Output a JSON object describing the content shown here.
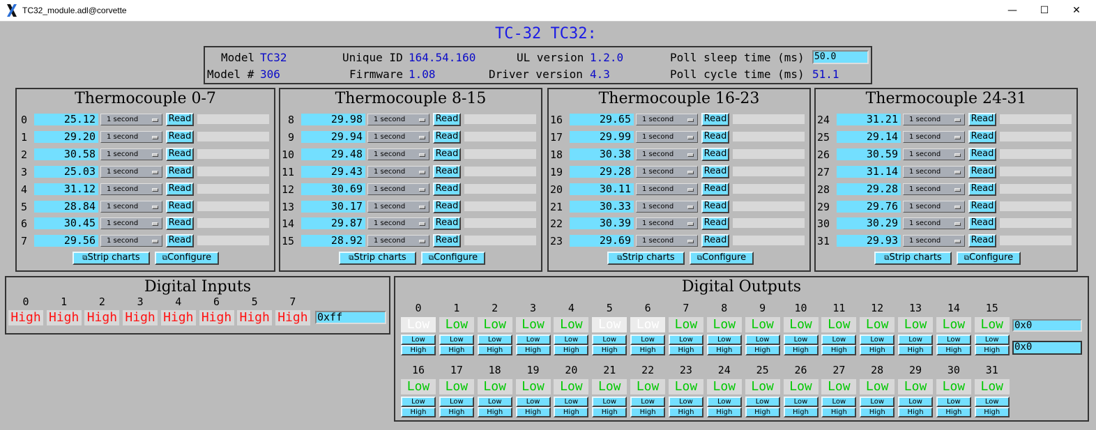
{
  "window": {
    "title": "TC32_module.adl@corvette",
    "minimize": "—",
    "maximize": "☐",
    "close": "✕"
  },
  "header": {
    "title": "TC-32  TC32:"
  },
  "info": {
    "model_label": "Model",
    "model_value": "TC32",
    "model_num_label": "Model #",
    "model_num_value": "306",
    "uid_label": "Unique ID",
    "uid_value": "164.54.160",
    "firmware_label": "Firmware",
    "firmware_value": "1.08",
    "ul_label": "UL version",
    "ul_value": "1.2.0",
    "driver_label": "Driver version",
    "driver_value": "4.3",
    "poll_sleep_label": "Poll sleep time (ms)",
    "poll_sleep_value": "50.0",
    "poll_cycle_label": "Poll cycle time (ms)",
    "poll_cycle_value": "51.1"
  },
  "thermocouples": {
    "scan_option": "1 second",
    "read_label": "Read",
    "strip_label": "Strip charts",
    "config_label": "Configure",
    "panels": [
      {
        "title": "Thermocouple 0-7",
        "channels": [
          {
            "ch": "0",
            "value": "25.12"
          },
          {
            "ch": "1",
            "value": "29.20"
          },
          {
            "ch": "2",
            "value": "30.58"
          },
          {
            "ch": "3",
            "value": "25.03"
          },
          {
            "ch": "4",
            "value": "31.12"
          },
          {
            "ch": "5",
            "value": "28.84"
          },
          {
            "ch": "6",
            "value": "30.45"
          },
          {
            "ch": "7",
            "value": "29.56"
          }
        ]
      },
      {
        "title": "Thermocouple 8-15",
        "channels": [
          {
            "ch": "8",
            "value": "29.98"
          },
          {
            "ch": "9",
            "value": "29.94"
          },
          {
            "ch": "10",
            "value": "29.48"
          },
          {
            "ch": "11",
            "value": "29.43"
          },
          {
            "ch": "12",
            "value": "30.69"
          },
          {
            "ch": "13",
            "value": "30.17"
          },
          {
            "ch": "14",
            "value": "29.87"
          },
          {
            "ch": "15",
            "value": "28.92"
          }
        ]
      },
      {
        "title": "Thermocouple 16-23",
        "channels": [
          {
            "ch": "16",
            "value": "29.65"
          },
          {
            "ch": "17",
            "value": "29.99"
          },
          {
            "ch": "18",
            "value": "30.38"
          },
          {
            "ch": "19",
            "value": "29.28"
          },
          {
            "ch": "20",
            "value": "30.11"
          },
          {
            "ch": "21",
            "value": "30.33"
          },
          {
            "ch": "22",
            "value": "30.39"
          },
          {
            "ch": "23",
            "value": "29.69"
          }
        ]
      },
      {
        "title": "Thermocouple 24-31",
        "channels": [
          {
            "ch": "24",
            "value": "31.21"
          },
          {
            "ch": "25",
            "value": "29.14"
          },
          {
            "ch": "26",
            "value": "30.59"
          },
          {
            "ch": "27",
            "value": "31.14"
          },
          {
            "ch": "28",
            "value": "29.28"
          },
          {
            "ch": "29",
            "value": "29.76"
          },
          {
            "ch": "30",
            "value": "30.29"
          },
          {
            "ch": "31",
            "value": "29.93"
          }
        ]
      }
    ]
  },
  "digital_inputs": {
    "title": "Digital Inputs",
    "bits": [
      {
        "label": "0",
        "state": "High"
      },
      {
        "label": "1",
        "state": "High"
      },
      {
        "label": "2",
        "state": "High"
      },
      {
        "label": "3",
        "state": "High"
      },
      {
        "label": "4",
        "state": "High"
      },
      {
        "label": "6",
        "state": "High"
      },
      {
        "label": "5",
        "state": "High"
      },
      {
        "label": "7",
        "state": "High"
      }
    ],
    "value": "0xff"
  },
  "digital_outputs": {
    "title": "Digital Outputs",
    "low_label": "Low",
    "high_label": "High",
    "row1": [
      {
        "label": "0",
        "state": "Low",
        "dim": true
      },
      {
        "label": "1",
        "state": "Low"
      },
      {
        "label": "2",
        "state": "Low"
      },
      {
        "label": "3",
        "state": "Low"
      },
      {
        "label": "4",
        "state": "Low"
      },
      {
        "label": "5",
        "state": "Low",
        "dim": true
      },
      {
        "label": "6",
        "state": "Low",
        "dim": true
      },
      {
        "label": "7",
        "state": "Low"
      },
      {
        "label": "8",
        "state": "Low"
      },
      {
        "label": "9",
        "state": "Low"
      },
      {
        "label": "10",
        "state": "Low"
      },
      {
        "label": "11",
        "state": "Low"
      },
      {
        "label": "12",
        "state": "Low"
      },
      {
        "label": "13",
        "state": "Low"
      },
      {
        "label": "14",
        "state": "Low"
      },
      {
        "label": "15",
        "state": "Low"
      }
    ],
    "row2": [
      {
        "label": "16",
        "state": "Low"
      },
      {
        "label": "17",
        "state": "Low"
      },
      {
        "label": "18",
        "state": "Low"
      },
      {
        "label": "19",
        "state": "Low"
      },
      {
        "label": "20",
        "state": "Low"
      },
      {
        "label": "21",
        "state": "Low"
      },
      {
        "label": "22",
        "state": "Low"
      },
      {
        "label": "23",
        "state": "Low"
      },
      {
        "label": "24",
        "state": "Low"
      },
      {
        "label": "25",
        "state": "Low"
      },
      {
        "label": "26",
        "state": "Low"
      },
      {
        "label": "27",
        "state": "Low"
      },
      {
        "label": "28",
        "state": "Low"
      },
      {
        "label": "29",
        "state": "Low"
      },
      {
        "label": "30",
        "state": "Low"
      },
      {
        "label": "31",
        "state": "Low"
      }
    ],
    "readback_value": "0x0",
    "write_value": "0x0"
  }
}
